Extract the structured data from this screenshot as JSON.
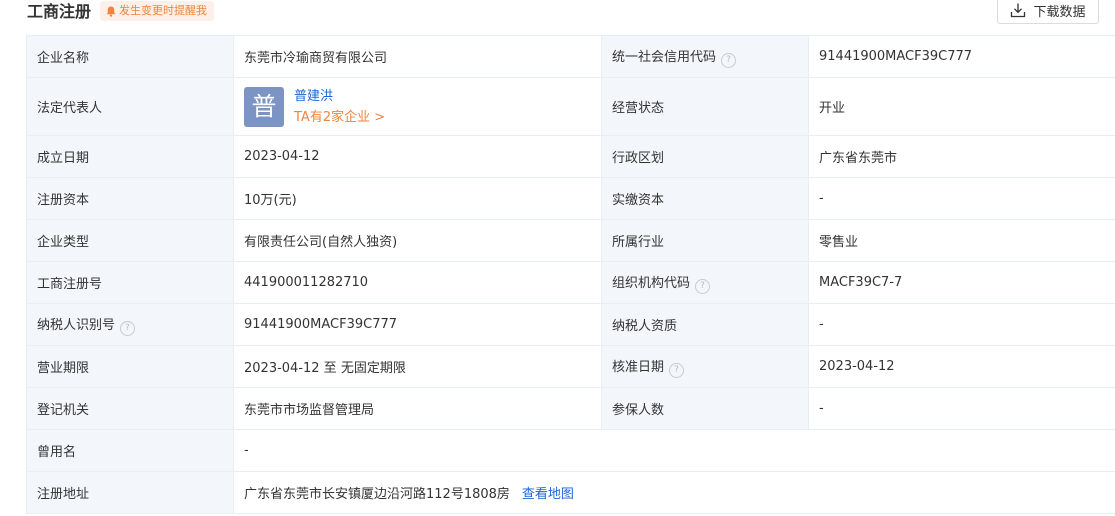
{
  "header": {
    "title": "工商注册",
    "notify_label": "发生变更时提醒我",
    "download_label": "下载数据"
  },
  "rows": {
    "company_name": {
      "label": "企业名称",
      "value": "东莞市冷瑜商贸有限公司"
    },
    "credit_code": {
      "label": "统一社会信用代码",
      "value": "91441900MACF39C777"
    },
    "legal_rep": {
      "label": "法定代表人",
      "avatar_char": "普",
      "name": "普建洪",
      "more": "TA有2家企业 >"
    },
    "status": {
      "label": "经营状态",
      "value": "开业"
    },
    "established": {
      "label": "成立日期",
      "value": "2023-04-12"
    },
    "region": {
      "label": "行政区划",
      "value": "广东省东莞市"
    },
    "reg_capital": {
      "label": "注册资本",
      "value": "10万(元)"
    },
    "paid_capital": {
      "label": "实缴资本",
      "value": "-"
    },
    "company_type": {
      "label": "企业类型",
      "value": "有限责任公司(自然人独资)"
    },
    "industry": {
      "label": "所属行业",
      "value": "零售业"
    },
    "reg_no": {
      "label": "工商注册号",
      "value": "441900011282710"
    },
    "org_code": {
      "label": "组织机构代码",
      "value": "MACF39C7-7"
    },
    "taxpayer_id": {
      "label": "纳税人识别号",
      "value": "91441900MACF39C777"
    },
    "taxpayer_qual": {
      "label": "纳税人资质",
      "value": "-"
    },
    "term": {
      "label": "营业期限",
      "value": "2023-04-12 至 无固定期限"
    },
    "approve_date": {
      "label": "核准日期",
      "value": "2023-04-12"
    },
    "authority": {
      "label": "登记机关",
      "value": "东莞市市场监督管理局"
    },
    "insured": {
      "label": "参保人数",
      "value": "-"
    },
    "former_name": {
      "label": "曾用名",
      "value": "-"
    },
    "address": {
      "label": "注册地址",
      "value": "广东省东莞市长安镇厦边沿河路112号1808房",
      "map_link": "查看地图"
    }
  },
  "help_icon_char": "?",
  "colors": {
    "link": "#1a66d6",
    "accent_orange": "#f0843c",
    "label_bg": "#f3f6fa",
    "border": "#e9eef3",
    "avatar_bg": "#7c94c4"
  }
}
